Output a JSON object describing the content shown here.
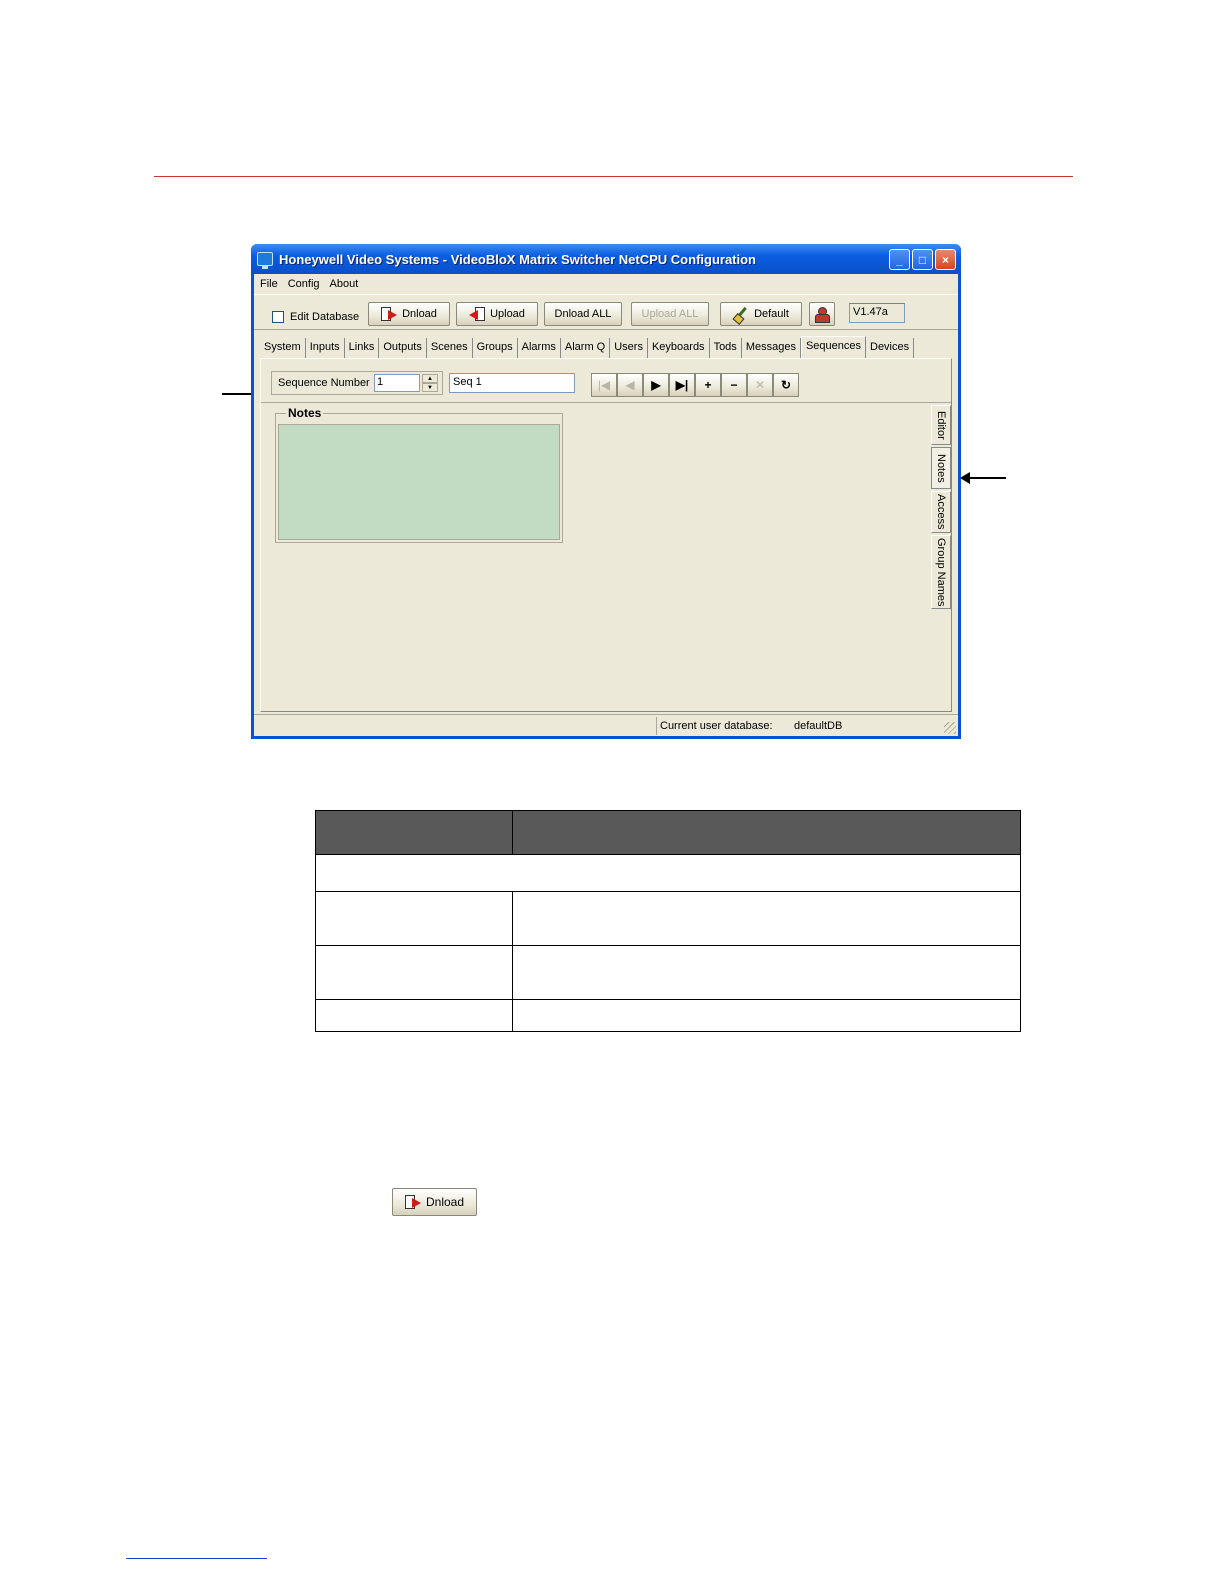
{
  "window": {
    "title": "Honeywell Video Systems - VideoBloX Matrix Switcher NetCPU Configuration",
    "min_label": "_",
    "max_label": "□",
    "close_label": "×"
  },
  "menu": [
    "File",
    "Config",
    "About"
  ],
  "toolbar": {
    "edit_database_label": "Edit Database",
    "dnload_label": "Dnload",
    "upload_label": "Upload",
    "dnload_all_label": "Dnload ALL",
    "upload_all_label": "Upload ALL",
    "default_label": "Default",
    "version": "V1.47a"
  },
  "tabs": [
    "System",
    "Inputs",
    "Links",
    "Outputs",
    "Scenes",
    "Groups",
    "Alarms",
    "Alarm Q",
    "Users",
    "Keyboards",
    "Tods",
    "Messages",
    "Sequences",
    "Devices"
  ],
  "active_tab": "Sequences",
  "sequence": {
    "number_label": "Sequence Number",
    "number_value": "1",
    "name_value": "Seq 1"
  },
  "nav_buttons": [
    "|◀",
    "◀",
    "▶",
    "▶|",
    "+",
    "−",
    "✕",
    "↻"
  ],
  "notes": {
    "title": "Notes"
  },
  "side_tabs": [
    "Editor",
    "Notes",
    "Access",
    "Group Names"
  ],
  "active_side_tab": "Notes",
  "status": {
    "label": "Current user database:",
    "value": "defaultDB"
  },
  "inline_button": {
    "label": "Dnload"
  }
}
